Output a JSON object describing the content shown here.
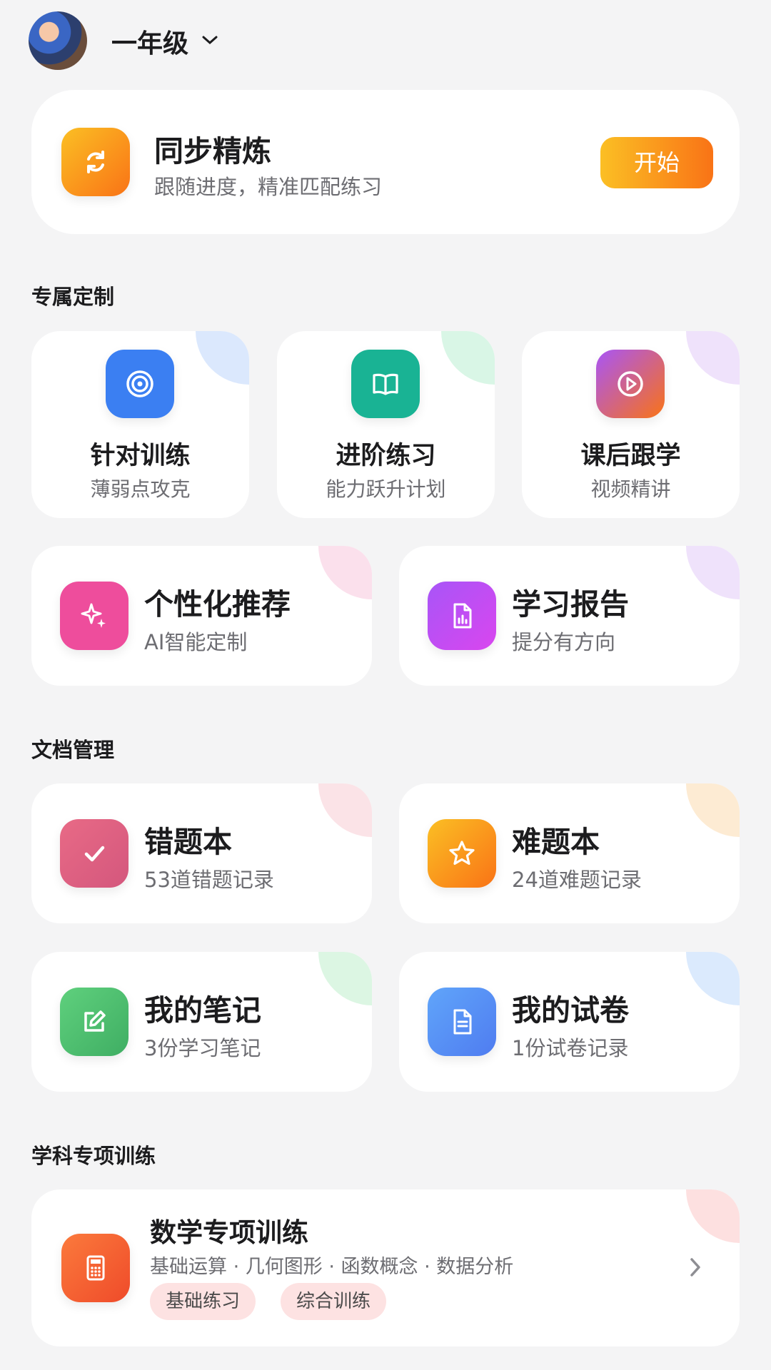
{
  "header": {
    "grade": "一年级"
  },
  "sync_card": {
    "title": "同步精炼",
    "subtitle": "跟随进度，精准匹配练习",
    "button": "开始"
  },
  "sections": {
    "custom": "专属定制",
    "docs": "文档管理",
    "subject": "学科专项训练"
  },
  "custom_cards": [
    {
      "title": "针对训练",
      "subtitle": "薄弱点攻克",
      "icon": "target-icon"
    },
    {
      "title": "进阶练习",
      "subtitle": "能力跃升计划",
      "icon": "book-icon"
    },
    {
      "title": "课后跟学",
      "subtitle": "视频精讲",
      "icon": "play-icon"
    }
  ],
  "wide_cards": [
    {
      "title": "个性化推荐",
      "subtitle": "AI智能定制",
      "icon": "sparkle-icon"
    },
    {
      "title": "学习报告",
      "subtitle": "提分有方向",
      "icon": "report-icon"
    }
  ],
  "doc_cards": [
    {
      "title": "错题本",
      "subtitle": "53道错题记录",
      "icon": "check-icon"
    },
    {
      "title": "难题本",
      "subtitle": "24道难题记录",
      "icon": "star-icon"
    },
    {
      "title": "我的笔记",
      "subtitle": "3份学习笔记",
      "icon": "edit-icon"
    },
    {
      "title": "我的试卷",
      "subtitle": "1份试卷记录",
      "icon": "document-icon"
    }
  ],
  "subject_card": {
    "title": "数学专项训练",
    "topics": "基础运算 · 几何图形 · 函数概念 · 数据分析",
    "tags": [
      "基础练习",
      "综合训练"
    ],
    "icon": "calculator-icon"
  },
  "colors": {
    "background": "#f4f4f5",
    "orange": "#f7931e",
    "blue": "#3b7ff2",
    "teal": "#19b394",
    "purple": "#c04be0",
    "pink": "#ee4d9c",
    "green": "#4fc16f"
  }
}
